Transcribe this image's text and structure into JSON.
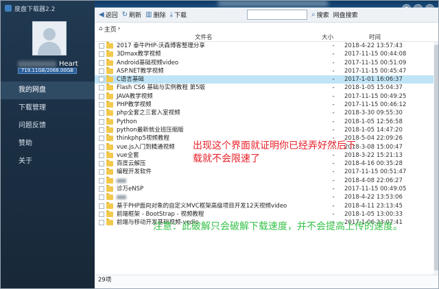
{
  "app": {
    "title": "度盘下载器2.2",
    "user_suffix": "Heart",
    "quota": "719.11GB/2068.00GB"
  },
  "sidebar": {
    "items": [
      {
        "label": "我的网盘"
      },
      {
        "label": "下载管理"
      },
      {
        "label": "问题反馈"
      },
      {
        "label": "赞助"
      },
      {
        "label": "关于"
      }
    ]
  },
  "toolbar": {
    "back": "返回",
    "refresh": "刷新",
    "delete": "删除",
    "download": "下载",
    "search_value": "",
    "search_btn": "搜索",
    "netdisk_search": "网盘搜索"
  },
  "breadcrumb": {
    "home": "主页"
  },
  "columns": {
    "name": "文件名",
    "size": "大小",
    "time": "时间"
  },
  "files": [
    {
      "name": "2017 泰牛PHP-沃森博客整理分享",
      "size": "-",
      "time": "2018-4-22 13:57:43"
    },
    {
      "name": "3Dmax教学视频",
      "size": "-",
      "time": "2017-11-15 00:44:08"
    },
    {
      "name": "Android基础视频video",
      "size": "-",
      "time": "2017-11-15 00:51:09"
    },
    {
      "name": "ASP.NET教学视频",
      "size": "-",
      "time": "2017-11-15 00:45:47"
    },
    {
      "name": "C语言基础",
      "size": "-",
      "time": "2017-1-01 16:06:37"
    },
    {
      "name": "Flash CS6 基础与实例教程 第5版",
      "size": "-",
      "time": "2018-1-05 15:04:37"
    },
    {
      "name": "JAVA教学视频",
      "size": "-",
      "time": "2017-11-15 00:49:25"
    },
    {
      "name": "PHP教学视频",
      "size": "-",
      "time": "2017-11-15 00:46:12"
    },
    {
      "name": "php全套之三套入室视频",
      "size": "-",
      "time": "2018-3-30 09:55:30"
    },
    {
      "name": "Python",
      "size": "-",
      "time": "2018-1-05 12:56:58"
    },
    {
      "name": "python最新就业班压缩版",
      "size": "-",
      "time": "2018-1-05 14:47:20"
    },
    {
      "name": "thinkphp5视频教程",
      "size": "-",
      "time": "2018-5-04 22:09:26"
    },
    {
      "name": "vue.js入门到精通视频",
      "size": "-",
      "time": "2018-3-08 15:00:47"
    },
    {
      "name": "vue全套",
      "size": "-",
      "time": "2018-3-22 15:21:13"
    },
    {
      "name": "百度云解压",
      "size": "-",
      "time": "2018-4-16 00:35:28"
    },
    {
      "name": "编程开发软件",
      "size": "-",
      "time": "2017-11-15 00:51:47"
    },
    {
      "name": "",
      "size": "-",
      "time": "2018-4-08 22:06:27"
    },
    {
      "name": "诊万eNSP",
      "size": "-",
      "time": "2017-11-15 00:49:05"
    },
    {
      "name": "",
      "size": "-",
      "time": "2018-4-22 13:53:06"
    },
    {
      "name": "基于PHP面向对象的自定义MVC框架高级项目开发12天视频video",
      "size": "-",
      "time": "2018-4-11 23:13:45"
    },
    {
      "name": "前端框架 - BootStrap - 视频教程",
      "size": "-",
      "time": "2018-1-05 13:00:33"
    },
    {
      "name": "前端与移动开发基础视频-vedio",
      "size": "-",
      "time": "2017-1-06 23:07:41"
    }
  ],
  "footer": {
    "count": "29项"
  },
  "annotations": {
    "red": "出现这个界面就证明你已经弄好然后下载就不会限速了",
    "green": "注意：此破解只会破解下载速度，并不会提高上传的速度。"
  }
}
